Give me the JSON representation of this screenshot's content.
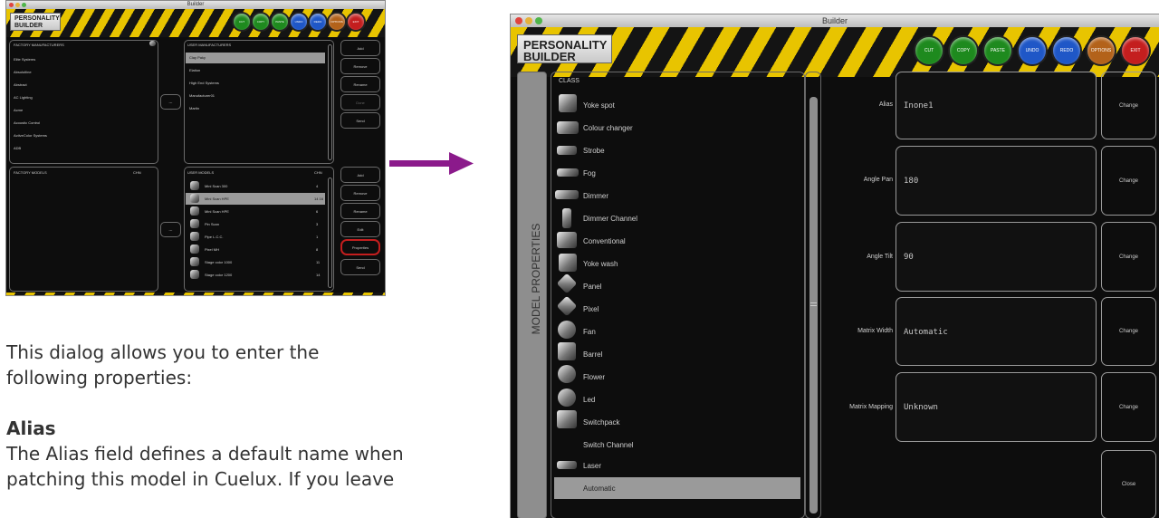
{
  "colors": {
    "arrow": "#8b1a8b",
    "highlight_ring": "#c41e1e",
    "yellow": "#e8c400",
    "red": "#c41e1e",
    "green": "#1e8a1e",
    "blue": "#1f57c7",
    "orange": "#b3621a"
  },
  "small_window": {
    "title": "Builder",
    "logo": [
      "PERSONALITY",
      "BUILDER"
    ],
    "buttons": [
      {
        "label": "CUT",
        "color": "green"
      },
      {
        "label": "COPY",
        "color": "green"
      },
      {
        "label": "PASTE",
        "color": "green"
      },
      {
        "label": "UNDO",
        "color": "blue"
      },
      {
        "label": "REDO",
        "color": "blue"
      },
      {
        "label": "OPTIONS",
        "color": "orange"
      },
      {
        "label": "EXIT",
        "color": "red"
      }
    ],
    "factory_manufacturers_header": "FACTORY MANUFACTURERS",
    "factory_manufacturers": [
      "Elite Systems",
      "Absolutline",
      "Abstract",
      "AC Lighting",
      "Acme",
      "Acoustic Control",
      "ActiveColor Systems",
      "ADB"
    ],
    "user_manufacturers_header": "USER MANUFACTURERS",
    "user_manufacturers": [
      "Clay Paky",
      "Elation",
      "High End Systems",
      "Manufacturer01",
      "Martin"
    ],
    "manufacturer_actions": [
      "Add",
      "Remove",
      "Rename",
      "Done",
      "Send"
    ],
    "transfer_label": "...",
    "factory_models_header": "FACTORY MODELS",
    "chn_header": "CHN",
    "user_models_header": "USER MODELS",
    "user_models": [
      {
        "name": "Mini Scan 300",
        "chn": "4"
      },
      {
        "name": "Mini Scan HPE",
        "chn": "14 16"
      },
      {
        "name": "Mini Scan HPE",
        "chn": "6"
      },
      {
        "name": "Pin Scan",
        "chn": "3"
      },
      {
        "name": "Pipe L.C.C.",
        "chn": "1"
      },
      {
        "name": "Pixel MH",
        "chn": "8"
      },
      {
        "name": "Stage color 1000",
        "chn": "11"
      },
      {
        "name": "Stage color 1200",
        "chn": "14"
      }
    ],
    "model_actions": [
      "Add",
      "Remove",
      "Rename",
      "Edit",
      "Properties",
      "Send"
    ]
  },
  "description": {
    "intro": "This dialog allows you to enter the following properties:",
    "alias_heading": "Alias",
    "alias_text_line1": "The Alias field defines a default name when",
    "alias_text_line2": "patching this model in Cuelux. If you leave"
  },
  "big_window": {
    "title": "Builder",
    "logo": [
      "PERSONALITY",
      "BUILDER"
    ],
    "buttons": [
      {
        "label": "CUT",
        "color": "green"
      },
      {
        "label": "COPY",
        "color": "green"
      },
      {
        "label": "PASTE",
        "color": "green"
      },
      {
        "label": "UNDO",
        "color": "blue"
      },
      {
        "label": "REDO",
        "color": "blue"
      },
      {
        "label": "OPTIONS",
        "color": "orange"
      },
      {
        "label": "EXIT",
        "color": "red"
      }
    ],
    "side_tab": "MODEL PROPERTIES",
    "class_header": "CLASS",
    "classes": [
      "Yoke spot",
      "Colour changer",
      "Strobe",
      "Fog",
      "Dimmer",
      "Dimmer Channel",
      "Conventional",
      "Yoke wash",
      "Panel",
      "Pixel",
      "Fan",
      "Barrel",
      "Flower",
      "Led",
      "Switchpack",
      "Switch Channel",
      "Laser",
      "Automatic"
    ],
    "selected_class": "Automatic",
    "properties": [
      {
        "label": "Alias",
        "value": "Inone1",
        "button": "Change"
      },
      {
        "label": "Angle Pan",
        "value": "180",
        "button": "Change"
      },
      {
        "label": "Angle Tilt",
        "value": "90",
        "button": "Change"
      },
      {
        "label": "Matrix Width",
        "value": "Automatic",
        "button": "Change"
      },
      {
        "label": "Matrix Mapping",
        "value": "Unknown",
        "button": "Change"
      }
    ],
    "close_label": "Close"
  }
}
